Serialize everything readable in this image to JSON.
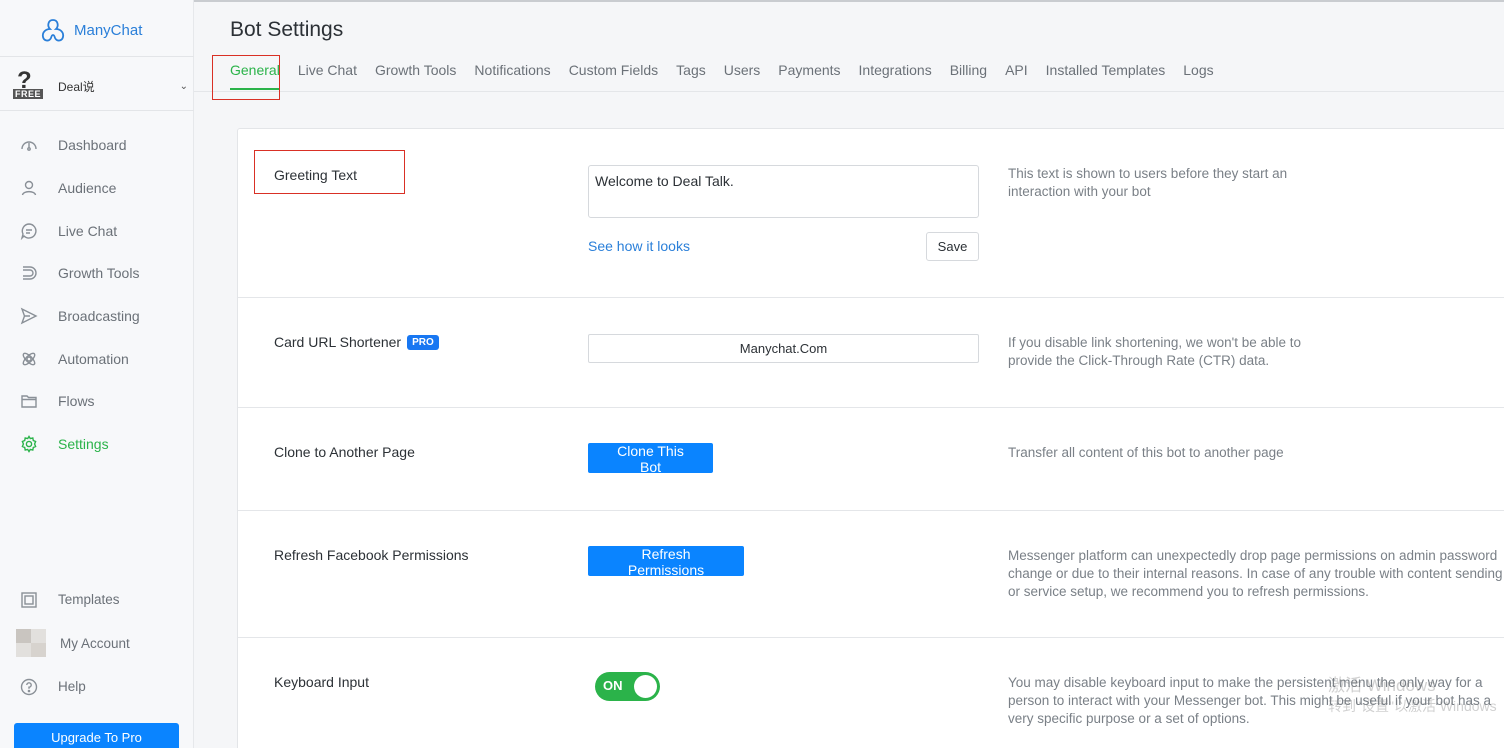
{
  "app": {
    "brand": "ManyChat"
  },
  "bot": {
    "badge": "FREE",
    "name": "Deal说"
  },
  "sidebar": {
    "items": [
      {
        "label": "Dashboard",
        "icon": "dashboard-icon"
      },
      {
        "label": "Audience",
        "icon": "audience-icon"
      },
      {
        "label": "Live Chat",
        "icon": "chat-icon"
      },
      {
        "label": "Growth Tools",
        "icon": "magnet-icon"
      },
      {
        "label": "Broadcasting",
        "icon": "send-icon"
      },
      {
        "label": "Automation",
        "icon": "automation-icon"
      },
      {
        "label": "Flows",
        "icon": "folder-icon"
      },
      {
        "label": "Settings",
        "icon": "gear-icon",
        "active": true
      }
    ],
    "bottom": {
      "templates": "Templates",
      "my_account": "My Account",
      "help": "Help",
      "upgrade": "Upgrade To Pro"
    }
  },
  "header": {
    "title": "Bot Settings",
    "tabs": [
      {
        "label": "General",
        "active": true
      },
      {
        "label": "Live Chat"
      },
      {
        "label": "Growth Tools"
      },
      {
        "label": "Notifications"
      },
      {
        "label": "Custom Fields"
      },
      {
        "label": "Tags"
      },
      {
        "label": "Users"
      },
      {
        "label": "Payments"
      },
      {
        "label": "Integrations"
      },
      {
        "label": "Billing"
      },
      {
        "label": "API"
      },
      {
        "label": "Installed Templates"
      },
      {
        "label": "Logs"
      }
    ]
  },
  "settings": {
    "greeting": {
      "label": "Greeting Text",
      "value": "Welcome to Deal Talk.",
      "link": "See how it looks",
      "save": "Save",
      "desc": "This text is shown to users before they start an interaction with your bot"
    },
    "url_shortener": {
      "label": "Card URL Shortener",
      "badge": "PRO",
      "value": "Manychat.Com",
      "desc": "If you disable link shortening, we won't be able to provide the Click-Through Rate (CTR) data."
    },
    "clone": {
      "label": "Clone to Another Page",
      "button": "Clone This Bot",
      "desc": "Transfer all content of this bot to another page"
    },
    "refresh": {
      "label": "Refresh Facebook Permissions",
      "button": "Refresh Permissions",
      "desc": "Messenger platform can unexpectedly drop page permissions on admin password change or due to their internal reasons. In case of any trouble with content sending or service setup, we recommend you to refresh permissions."
    },
    "keyboard": {
      "label": "Keyboard Input",
      "toggle": "ON",
      "desc": "You may disable keyboard input to make the persistent menu the only way for a person to interact with your Messenger bot. This might be useful if your bot has a very specific purpose or a set of options."
    }
  },
  "watermark": {
    "line1": "激活 Windows",
    "line2": "转到\"设置\"以激活 Windows"
  },
  "colors": {
    "accent_green": "#2bb34a",
    "primary_blue": "#0a84ff",
    "link_blue": "#2a7fd9",
    "annotation_red": "#d93025"
  }
}
